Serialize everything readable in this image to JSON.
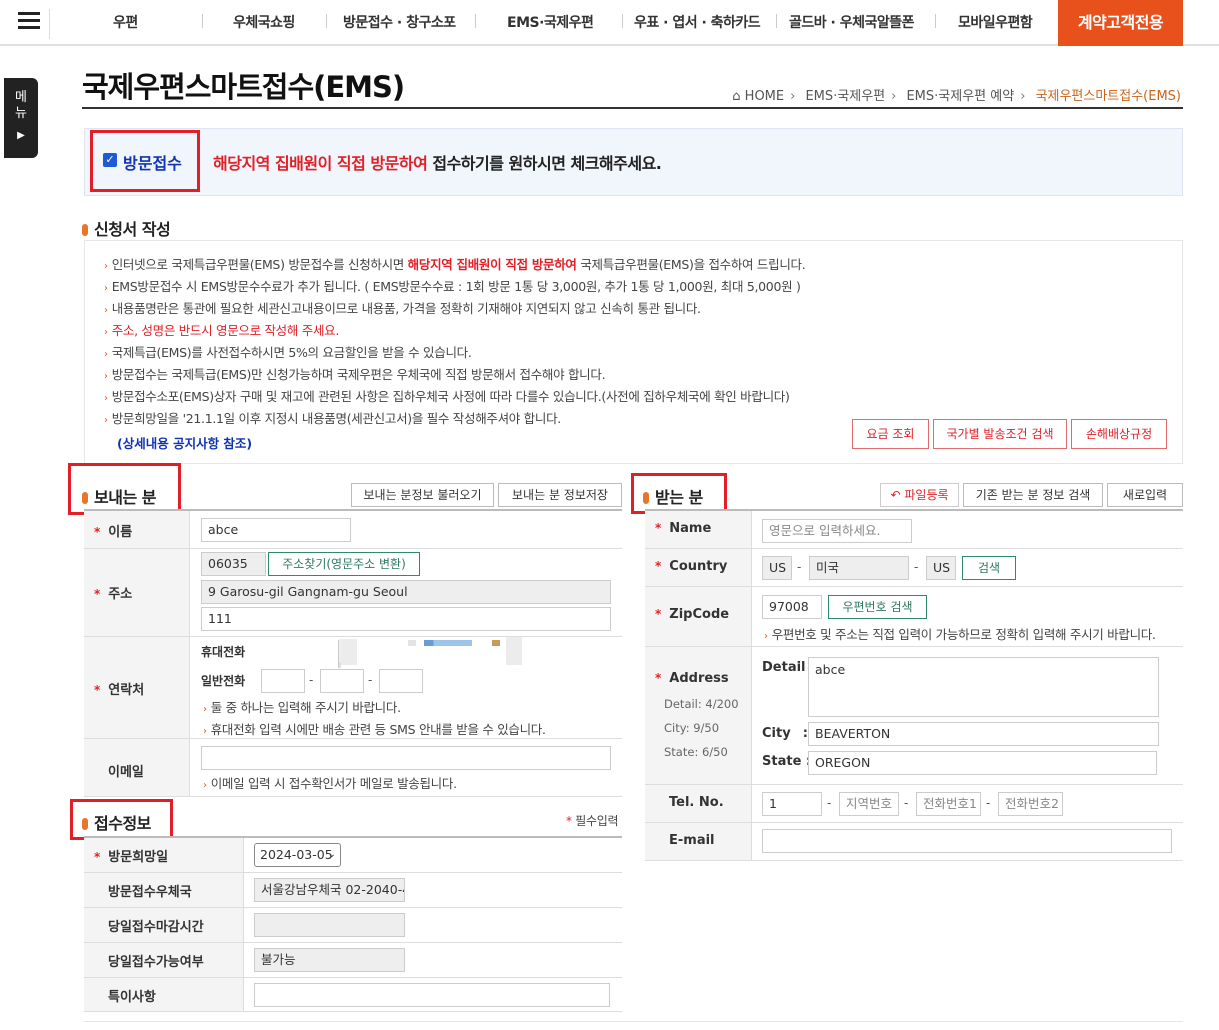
{
  "nav": {
    "items": [
      "우편",
      "우체국쇼핑",
      "방문접수 · 창구소포",
      "EMS·국제우편",
      "우표 · 엽서 · 축하카드",
      "골드바 · 우체국알뜰폰",
      "모바일우편함"
    ],
    "corporate": "계약고객전용"
  },
  "sidetab": {
    "label": "메뉴"
  },
  "page": {
    "title": "국제우편스마트접수(EMS)"
  },
  "breadcrumb": {
    "home": "HOME",
    "l1": "EMS·국제우편",
    "l2": "EMS·국제우편 예약",
    "current": "국제우편스마트접수(EMS)"
  },
  "visit": {
    "label": "방문접수",
    "checked": true,
    "msg_red": "해당지역 집배원이 직접 방문하여",
    "msg_rest": " 접수하기를 원하시면 체크해주세요."
  },
  "apply": {
    "title": "신청서 작성",
    "lines": [
      {
        "pre": "인터넷으로 국제특급우편물(EMS) 방문접수를 신청하시면 ",
        "red": "해당지역 집배원이 직접 방문하여",
        "post": " 국제특급우편물(EMS)을 접수하여 드립니다."
      },
      {
        "text": "EMS방문접수 시 EMS방문수수료가 추가 됩니다. ( EMS방문수수료 : 1회 방문 1통 당 3,000원, 추가 1통 당 1,000원, 최대 5,000원 )"
      },
      {
        "text": "내용품명란은 통관에 필요한 세관신고내용이므로 내용품, 가격을 정확히 기재해야 지연되지 않고 신속히 통관 됩니다."
      },
      {
        "text": "주소, 성명은 반드시 영문으로 작성해 주세요."
      },
      {
        "text": "국제특급(EMS)를 사전접수하시면 5%의 요금할인을 받을 수 있습니다."
      },
      {
        "text": "방문접수는 국제특급(EMS)만 신청가능하며 국제우편은 우체국에 직접 방문해서 접수해야 합니다."
      },
      {
        "text": "방문접수소포(EMS)상자 구매 및 재고에 관련된 사항은 집하우체국 사정에 따라 다를수 있습니다.(사전에 집하우체국에 확인 바랍니다)"
      },
      {
        "text": "방문희망일을 '21.1.1일 이후 지정시 내용품명(세관신고서)을 필수 작성해주셔야 합니다."
      }
    ],
    "notice_link": "(상세내용 공지사항 참조)",
    "btn_fee": "요금 조회",
    "btn_country": "국가별 발송조건 검색",
    "btn_damage": "손해배상규정"
  },
  "sender": {
    "title": "보내는 분",
    "btn_load": "보내는 분정보 불러오기",
    "btn_save": "보내는 분 정보저장",
    "name_label": "이름",
    "name": "abce",
    "addr_label": "주소",
    "zip": "06035",
    "addr_btn": "주소찾기(영문주소 변환)",
    "addr1": "9 Garosu-gil Gangnam-gu Seoul",
    "addr2": "111",
    "contact_label": "연락처",
    "mobile_label": "휴대전화",
    "phone_label": "일반전화",
    "contact_note1": "둘 중 하나는 입력해 주시기 바랍니다.",
    "contact_note2": "휴대전화 입력 시에만 배송 관련 등 SMS 안내를 받을 수 있습니다.",
    "email_label": "이메일",
    "email_note": "이메일 입력 시 접수확인서가 메일로 발송됩니다."
  },
  "receipt": {
    "title": "접수정보",
    "required_note": "필수입력",
    "date_label": "방문희망일",
    "date": "2024-03-05",
    "office_label": "방문접수우체국",
    "office": "서울강남우체국 02-2040-4",
    "deadline_label": "당일접수마감시간",
    "deadline": "",
    "avail_label": "당일접수가능여부",
    "avail": "불가능",
    "special_label": "특이사항"
  },
  "receiver": {
    "title": "받는 분",
    "btn_file": "파일등록",
    "btn_search": "기존 받는 분 정보 검색",
    "btn_new": "새로입력",
    "name_label": "Name",
    "name_ph": "영문으로 입력하세요.",
    "country_label": "Country",
    "country_code": "US",
    "country_name": "미국",
    "country_code2": "US",
    "country_btn": "검색",
    "zip_label": "ZipCode",
    "zip": "97008",
    "zip_btn": "우편번호 검색",
    "zip_note": "우편번호 및 주소는 직접 입력이 가능하므로 정확히 입력해 주시기 바랍니다.",
    "addr_label": "Address",
    "detail_count": "Detail: 4/200",
    "city_count": "City: 9/50",
    "state_count": "State: 6/50",
    "detail_label": "Detail :",
    "detail": "abce",
    "city_label": "City",
    "city": "BEAVERTON",
    "state_label": "State :",
    "state": "OREGON",
    "tel_label": "Tel. No.",
    "tel1": "1",
    "tel2": "지역번호",
    "tel3": "전화번호1",
    "tel4": "전화번호2",
    "email_label": "E-mail"
  },
  "colors": {
    "accent": "#e8501c",
    "highlight": "#e21f26",
    "link": "#1033b5",
    "teal": "#2e7a60"
  }
}
